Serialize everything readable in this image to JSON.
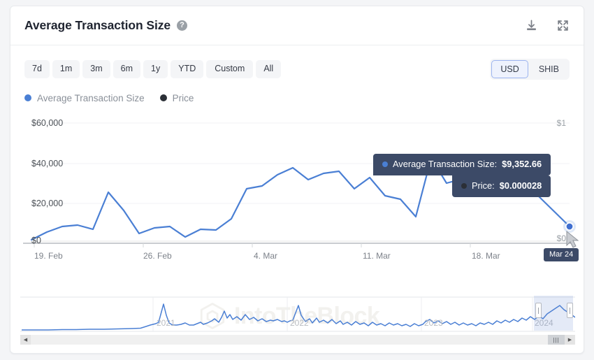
{
  "header": {
    "title": "Average Transaction Size",
    "help_icon": "help-circle-icon",
    "help_glyph": "?",
    "download_icon": "download-icon",
    "expand_icon": "expand-icon"
  },
  "controls": {
    "ranges": [
      {
        "label": "7d",
        "active": false
      },
      {
        "label": "1m",
        "active": false
      },
      {
        "label": "3m",
        "active": false
      },
      {
        "label": "6m",
        "active": false
      },
      {
        "label": "1y",
        "active": false
      },
      {
        "label": "YTD",
        "active": false
      },
      {
        "label": "Custom",
        "active": false
      },
      {
        "label": "All",
        "active": false
      }
    ],
    "currencies": [
      {
        "label": "USD",
        "active": true
      },
      {
        "label": "SHIB",
        "active": false
      }
    ]
  },
  "legend": [
    {
      "label": "Average Transaction Size",
      "color": "#4a7fd4"
    },
    {
      "label": "Price",
      "color": "#2b2f36"
    }
  ],
  "tooltip": {
    "series_label": "Average Transaction Size:",
    "series_value": "$9,352.66",
    "price_label": "Price:",
    "price_value": "$0.000028",
    "x_label": "Mar 24"
  },
  "watermark": {
    "text": "IntoTheBlock",
    "logo_icon": "cube-logo-icon"
  },
  "navigator": {
    "years": [
      "2021",
      "2022",
      "2023",
      "2024"
    ],
    "left_arrow": "◀",
    "right_arrow": "▶",
    "grip": "|||"
  },
  "colors": {
    "series_line": "#4a7fd4",
    "price_dot": "#2b2f36",
    "accent": "#3c4a67",
    "accent_border": "#9cb4ef",
    "grid": "#f1f2f4",
    "axis_text": "#6b7077"
  },
  "chart_data": {
    "type": "line",
    "title": "Average Transaction Size",
    "xlabel": "",
    "ylabel": "",
    "grid": true,
    "legend_position": "top-left",
    "y_axis_left": {
      "ticks": [
        "$0",
        "$20,000",
        "$40,000",
        "$60,000"
      ],
      "values": [
        0,
        20000,
        40000,
        60000
      ],
      "ylim": [
        0,
        67000
      ]
    },
    "y_axis_right": {
      "ticks": [
        "$0",
        "$1"
      ],
      "values": [
        0,
        1
      ],
      "ylim": [
        0,
        1.1
      ]
    },
    "x_ticks": [
      "19. Feb",
      "26. Feb",
      "4. Mar",
      "11. Mar",
      "18. Mar"
    ],
    "x_tick_positions": [
      0,
      7,
      14,
      21,
      28
    ],
    "series": [
      {
        "name": "Average Transaction Size",
        "color": "#4a7fd4",
        "unit": "USD",
        "x": [
          0,
          1,
          2,
          3,
          4,
          5,
          6,
          7,
          8,
          9,
          10,
          11,
          12,
          13,
          14,
          15,
          16,
          17,
          18,
          19,
          20,
          21,
          22,
          23,
          24,
          25,
          26,
          27,
          28,
          29,
          30,
          31,
          32,
          33,
          34
        ],
        "values": [
          1800,
          6200,
          9500,
          10300,
          7900,
          28400,
          18200,
          5300,
          8400,
          9200,
          3500,
          7900,
          7200,
          13600,
          30500,
          32000,
          38200,
          42000,
          35600,
          38800,
          40200,
          30500,
          36500,
          26500,
          24500,
          14800,
          47500,
          33500,
          35800,
          29500,
          37600,
          28800,
          33000,
          26200,
          9353
        ]
      },
      {
        "name": "Price",
        "color": "#2b2f36",
        "unit": "USD",
        "x": [
          0,
          34
        ],
        "values": [
          2.8e-05,
          2.8e-05
        ],
        "note": "flat near $0 on right axis"
      }
    ],
    "annotations": [
      {
        "type": "tooltip",
        "x": 34,
        "series_value": 9352.66,
        "price_value": 2.8e-05,
        "x_label": "Mar 24"
      }
    ],
    "navigator_series": {
      "name": "Average Transaction Size (full history)",
      "color": "#4a7fd4",
      "x_labels": [
        "2021",
        "2022",
        "2023",
        "2024"
      ],
      "values": [
        200,
        220,
        210,
        230,
        240,
        260,
        250,
        280,
        300,
        320,
        340,
        360,
        400,
        520,
        1100,
        9500,
        4200,
        1900,
        1500,
        1700,
        2600,
        1600,
        1500,
        1800,
        2800,
        3300,
        2600,
        3000,
        4200,
        3000,
        3400,
        4900,
        3000,
        6800,
        9700,
        4300,
        6500,
        3200,
        2600,
        8600,
        3200,
        3500,
        4000,
        3300,
        4500,
        3100,
        3900,
        3000,
        4200,
        2900,
        3500,
        2600,
        3300,
        2500,
        3100,
        2400,
        2900,
        2200,
        3000,
        2100,
        2800,
        2000,
        2700,
        3400,
        2600,
        3000,
        2500,
        2800,
        2400,
        2700,
        2300,
        3100,
        2500,
        2900,
        2600,
        3200,
        2700,
        3400,
        3000,
        3600,
        3300,
        4200,
        3800,
        4600,
        5200,
        7200,
        6400,
        9200
      ],
      "selection_start_pct": 92.5,
      "selection_end_pct": 99.5
    }
  }
}
